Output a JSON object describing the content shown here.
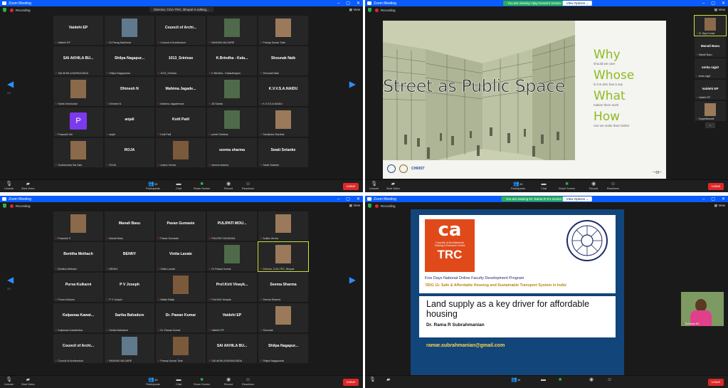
{
  "common": {
    "app_title": "Zoom Meeting",
    "recording": "Recording",
    "view": "View",
    "view_options": "View Options",
    "leave": "Leave",
    "toolbar": {
      "unmute": "Unmute",
      "start_video": "Start Video",
      "participants": "Participants",
      "chat": "Chat",
      "share_screen": "Share Screen",
      "record": "Record",
      "reactions": "Reactions"
    },
    "icons": {
      "mic": "mic-icon",
      "video": "video-off-icon",
      "participants": "participants-icon",
      "chat": "chat-icon",
      "share": "share-screen-icon",
      "record": "record-icon",
      "reactions": "reactions-icon"
    },
    "colors": {
      "title_blue": "#0b5cff",
      "leave_red": "#e02828",
      "share_green": "#2cb04a",
      "tile_bg": "#262626"
    }
  },
  "top_left": {
    "speaker_banner": "Director, COA-TRC, Bhopal is talking...",
    "page": "1/2",
    "participants_count": "45",
    "tiles": [
      {
        "name": "Vaidehi EP",
        "label": "Vaidehi EP"
      },
      {
        "name": "",
        "label": "Dr Parag Narkhede"
      },
      {
        "name": "Council of Archi...",
        "label": "Council of Architecture"
      },
      {
        "name": "",
        "label": "BHAVNA VALDARE"
      },
      {
        "name": "",
        "label": "Pranay Kumar Tode"
      },
      {
        "name": "SAI AKHILA BU...",
        "label": "SAI AKHILA BURAGADDA"
      },
      {
        "name": "Shilpa Nagapur...",
        "label": "Shilpa Nagapurkar"
      },
      {
        "name": "1013_Srinivas",
        "label": "1013_Srinivas"
      },
      {
        "name": "K.Brindha - Kala...",
        "label": "K.Brindha - Kalasalingam"
      },
      {
        "name": "Shounak Naik",
        "label": "Shounak Naik"
      },
      {
        "name": "",
        "label": "Sarita Vinchurkar"
      },
      {
        "name": "Dhinesh N",
        "label": "Dhinesh N"
      },
      {
        "name": "Mahima Jagade...",
        "label": "Mahima Jagadeesan"
      },
      {
        "name": "",
        "label": "Ali Sardar"
      },
      {
        "name": "K.V.V.S.A.NAIDU",
        "label": "K.V.V.S.A.NAIDU"
      },
      {
        "name": "",
        "label": "Prasanth Giri"
      },
      {
        "name": "anjali",
        "label": "anjali"
      },
      {
        "name": "Kotil Patil",
        "label": "Kotil Patil"
      },
      {
        "name": "",
        "label": "preeti Shekhar"
      },
      {
        "name": "",
        "label": "Samiksha Shirdhar"
      },
      {
        "name": "",
        "label": "Sudheendra Sai Sale"
      },
      {
        "name": "ROJA",
        "label": "ROJA"
      },
      {
        "name": "",
        "label": "Anshu Verma"
      },
      {
        "name": "seema sharma",
        "label": "seema sharma"
      },
      {
        "name": "Swati Solanke",
        "label": "Swati Solanke"
      }
    ]
  },
  "top_right": {
    "share_banner": "You are viewing Vijay Kumar's screen",
    "participants_count": "45",
    "slide": {
      "title": "Street as Public Space",
      "why": "Why",
      "why_sub": "should we care",
      "whose": "Whose",
      "whose_sub": "is it & who has a say",
      "what": "What",
      "what_sub": "makes them work",
      "how": "How",
      "how_sub": "can we make them better",
      "christ_logo": "CHRIST"
    },
    "strip": [
      {
        "name": "",
        "label": "Dr Vijay Kumar"
      },
      {
        "name": "Manali Basu",
        "label": "Manali Basu"
      },
      {
        "name": "smita rajpit",
        "label": "smita rajpit"
      },
      {
        "name": "Vaidehi EP",
        "label": "Vaidehi EP"
      },
      {
        "name": "",
        "label": "Sugandhanaik"
      }
    ]
  },
  "bottom_left": {
    "page": "2/2",
    "participants_count": "45",
    "tiles": [
      {
        "name": "",
        "label": "Prasanth S"
      },
      {
        "name": "Manali Basu",
        "label": "Manali Basu"
      },
      {
        "name": "Pavan Gumaste",
        "label": "Pavan Gumaste"
      },
      {
        "name": "PULIPATI MOU...",
        "label": "PULIPATI MOUNIKA"
      },
      {
        "name": "",
        "label": "Ankita Verma"
      },
      {
        "name": "Benitha Methach",
        "label": "Benitha Methach"
      },
      {
        "name": "BENNY",
        "label": "BENNY"
      },
      {
        "name": "Vinita Lavate",
        "label": "Vinita Lavate"
      },
      {
        "name": "",
        "label": "Dr Pawan Kumar"
      },
      {
        "name": "",
        "label": "Director, COA-TRC, Bhopal"
      },
      {
        "name": "Purva Kulkarni",
        "label": "Purva Kulkarni"
      },
      {
        "name": "P V Joseph",
        "label": "P V Joseph"
      },
      {
        "name": "",
        "label": "Wakle Balaji"
      },
      {
        "name": "Prof.Kirti Vinayk...",
        "label": "Prof.Kirti Vinayak"
      },
      {
        "name": "Seema Sharma",
        "label": "Seema Sharma"
      },
      {
        "name": "Kalpanaa Kawat...",
        "label": "Kalpanaa Kawathekar"
      },
      {
        "name": "Sarika Bahadure",
        "label": "Sarika Bahadure"
      },
      {
        "name": "Dr. Pawan Kumar",
        "label": "Dr. Pawan Kumar"
      },
      {
        "name": "Vaidehi EP",
        "label": "Vaidehi EP"
      },
      {
        "name": "",
        "label": "Shounak"
      },
      {
        "name": "Council of Archi...",
        "label": "Council of Architecture"
      },
      {
        "name": "",
        "label": "BHAVNA VALDARE"
      },
      {
        "name": "",
        "label": "Pranay Kumar Tode"
      },
      {
        "name": "SAI AKHILA BU...",
        "label": "SAI AKHILA BURAGADDA"
      },
      {
        "name": "Shilpa Nagapur...",
        "label": "Shilpa Nagapurkar"
      }
    ]
  },
  "bottom_right": {
    "share_banner": "You are viewing Dr. Rama R S's screen",
    "participants_count": "45",
    "slide": {
      "logo_top": "ca",
      "logo_sub1": "Council of Architecture",
      "logo_sub2": "Training & Research Centre",
      "logo_bottom": "TRC",
      "program": "Five Days National Online Faculty Development Program",
      "theme": "'SDG 11: Safe & Affordable Housing and Sustainable Transport System in India'",
      "title": "Land supply as a key driver for affordable housing",
      "author": "Dr. Rama R Subrahmanian",
      "email": "ramar.subrahmanian@gmail.com"
    },
    "presenter_label": "Dr.Rama RS"
  }
}
